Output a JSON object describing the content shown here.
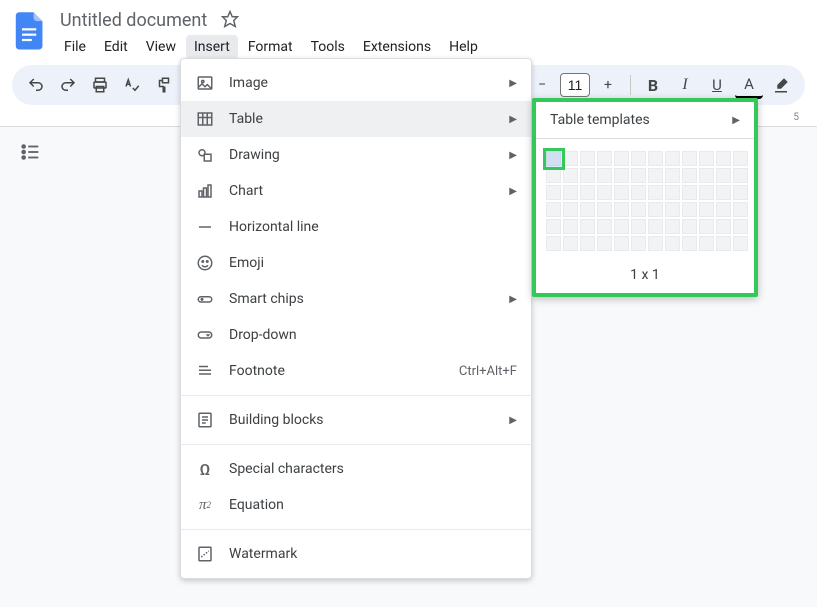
{
  "doc": {
    "title": "Untitled document"
  },
  "menubar": {
    "file": "File",
    "edit": "Edit",
    "view": "View",
    "insert": "Insert",
    "format": "Format",
    "tools": "Tools",
    "extensions": "Extensions",
    "help": "Help"
  },
  "toolbar": {
    "font_size": "11"
  },
  "ruler": {
    "mark_5": "5"
  },
  "insert_menu": {
    "image": "Image",
    "table": "Table",
    "drawing": "Drawing",
    "chart": "Chart",
    "horizontal_line": "Horizontal line",
    "emoji": "Emoji",
    "smart_chips": "Smart chips",
    "dropdown": "Drop-down",
    "footnote": "Footnote",
    "footnote_shortcut": "Ctrl+Alt+F",
    "building_blocks": "Building blocks",
    "special_chars": "Special characters",
    "equation": "Equation",
    "watermark": "Watermark"
  },
  "table_submenu": {
    "templates": "Table templates",
    "dimensions": "1 x 1"
  }
}
